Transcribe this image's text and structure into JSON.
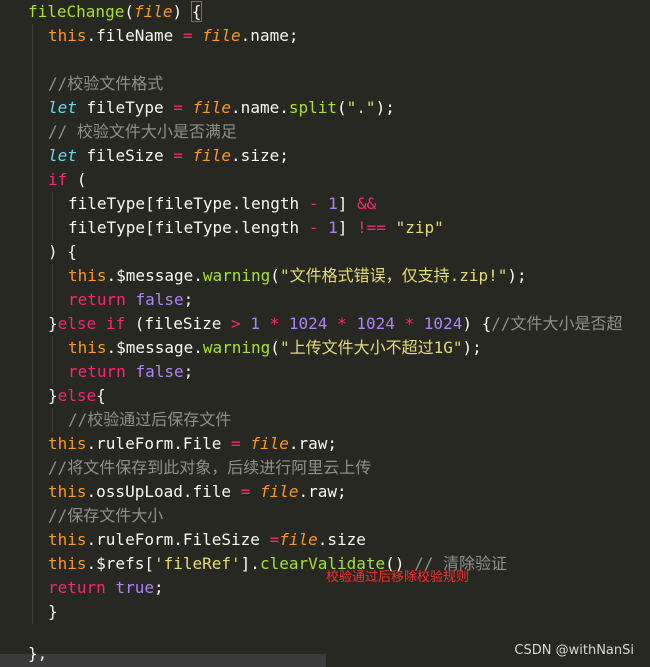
{
  "code_lines": [
    "fileChange(file) {",
    "this.fileName = file.name;",
    "",
    "//校验文件格式",
    "let fileType = file.name.split(\".\");",
    "// 校验文件大小是否满足",
    "let fileSize = file.size;",
    "if (",
    "fileType[fileType.length - 1] &&",
    "fileType[fileType.length - 1] !== \"zip\"",
    ") {",
    "this.$message.warning(\"文件格式错误，仅支持.zip!\");",
    "return false;",
    "}else if (fileSize > 1 * 1024 * 1024 * 1024) {//文件大小是否超",
    "this.$message.warning(\"上传文件大小不超过1G\");",
    "return false;",
    "}else{",
    "//校验通过后保存文件",
    "this.ruleForm.File = file.raw;",
    "//将文件保存到此对象，后续进行阿里云上传",
    "this.ossUpLoad.file = file.raw;",
    "//保存文件大小",
    "this.ruleForm.FileSize =file.size",
    "this.$refs['fileRef'].clearValidate() // 清除验证",
    "return true;",
    "}"
  ],
  "annotation": "校验通过后移除校验规则",
  "watermark": "CSDN @withNanSi"
}
